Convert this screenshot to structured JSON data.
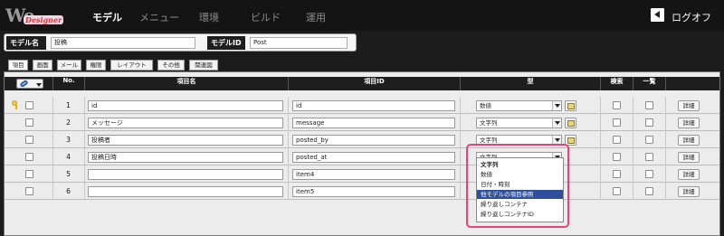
{
  "app": {
    "logo_main": "We",
    "logo_sub": "Designer"
  },
  "nav": [
    "モデル",
    "メニュー",
    "環境",
    "ビルド",
    "運用"
  ],
  "logout": "ログオフ",
  "model": {
    "name_label": "モデル名",
    "name_value": "投稿",
    "id_label": "モデルID",
    "id_value": "Post"
  },
  "tabs": [
    "項目",
    "画面",
    "メール",
    "権限",
    "レイアウト",
    "その他",
    "関連図"
  ],
  "table": {
    "headers": {
      "no": "No.",
      "item_name": "項目名",
      "item_id": "項目ID",
      "type": "型",
      "search": "検索",
      "list": "一覧"
    },
    "detail_label": "詳細",
    "rows": [
      {
        "no": "1",
        "name": "id",
        "id": "id",
        "type": "数値"
      },
      {
        "no": "2",
        "name": "メッセージ",
        "id": "message",
        "type": "文字列"
      },
      {
        "no": "3",
        "name": "投稿者",
        "id": "posted_by",
        "type": "文字列"
      },
      {
        "no": "4",
        "name": "投稿日時",
        "id": "posted_at",
        "type": "文字列"
      },
      {
        "no": "5",
        "name": "",
        "id": "item4",
        "type": ""
      },
      {
        "no": "6",
        "name": "",
        "id": "item5",
        "type": ""
      }
    ]
  },
  "type_options": [
    "文字列",
    "数値",
    "日付・時刻",
    "他モデルの項目参照",
    "繰り返しコンテナ",
    "繰り返しコンテナID"
  ],
  "type_options_selected": "他モデルの項目参照",
  "colors": {
    "accent_highlight": "#e8417d",
    "selected_option": "#2f4f9c"
  }
}
